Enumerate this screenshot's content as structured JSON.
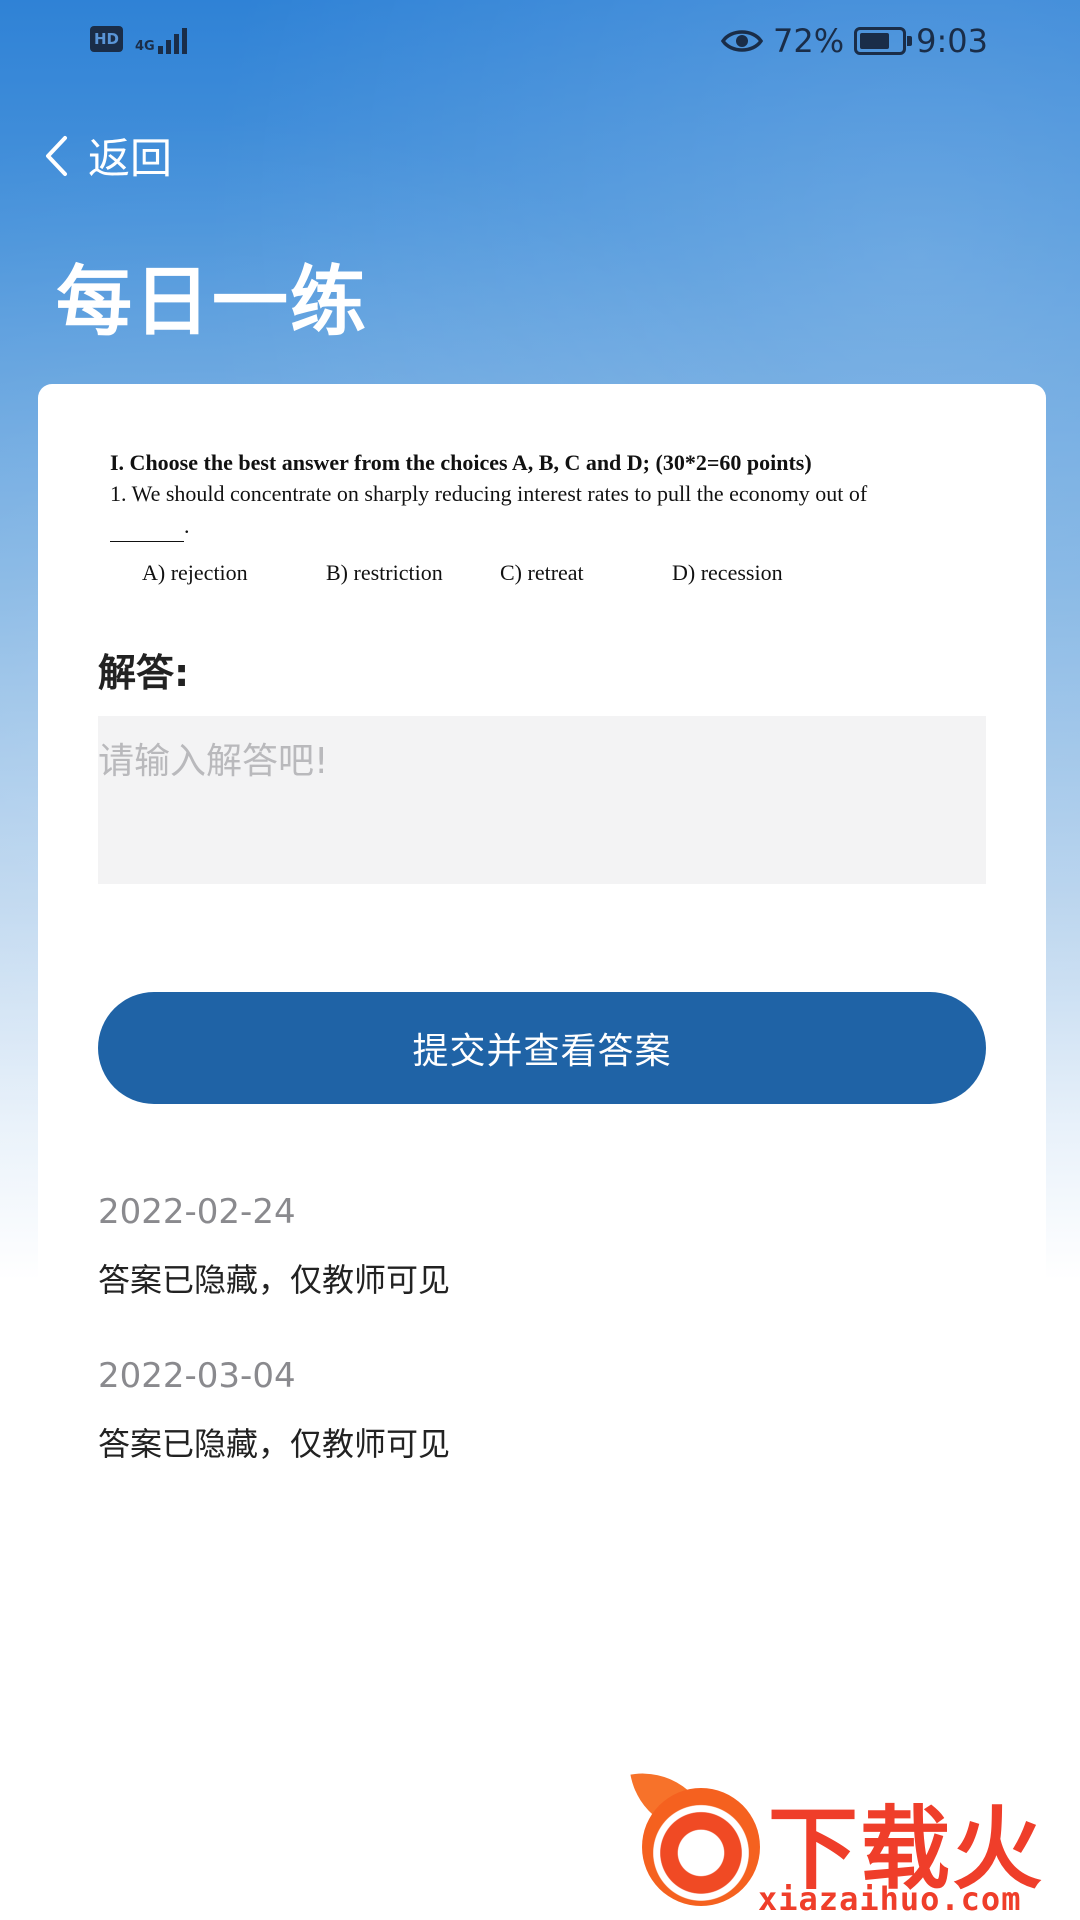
{
  "status_bar": {
    "hd": "HD",
    "network": "4G",
    "battery_pct": "72%",
    "battery_level": 0.72,
    "time": "9:03"
  },
  "header": {
    "back_label": "返回",
    "title": "每日一练"
  },
  "question": {
    "heading": "I. Choose the best answer from the choices A, B, C and D; (30*2=60  points)",
    "text": "1. We should concentrate on sharply reducing interest rates to pull the economy out of",
    "blank_suffix": ".",
    "options": [
      "A) rejection",
      "B) restriction",
      "C) retreat",
      "D) recession"
    ]
  },
  "answer": {
    "label": "解答:",
    "placeholder": "请输入解答吧!"
  },
  "submit": {
    "label": "提交并查看答案"
  },
  "history": [
    {
      "date": "2022-02-24",
      "text": "答案已隐藏，仅教师可见"
    },
    {
      "date": "2022-03-04",
      "text": "答案已隐藏，仅教师可见"
    }
  ],
  "watermark": {
    "cn": "下载火",
    "en": "xiazaihuo.com"
  },
  "colors": {
    "primary": "#1f63a6",
    "header_gradient_top": "#2f82d6",
    "watermark": "#ef3e2a"
  },
  "icons": [
    "eye-icon",
    "battery-icon",
    "signal-icon",
    "back-chevron-icon",
    "download-icon"
  ]
}
